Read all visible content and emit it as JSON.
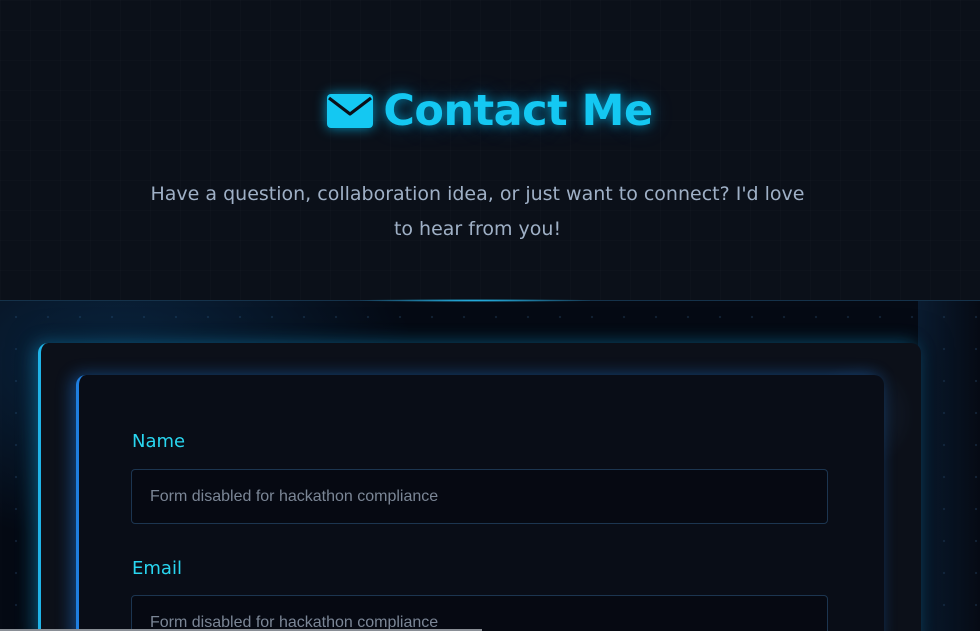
{
  "header": {
    "title": "Contact Me",
    "icon": "envelope-icon",
    "subtitle": "Have a question, collaboration idea, or just want to connect? I'd love to hear from you!"
  },
  "form": {
    "name_label": "Name",
    "name_placeholder": "Form disabled for hackathon compliance",
    "email_label": "Email",
    "email_placeholder": "Form disabled for hackathon compliance"
  },
  "colors": {
    "accent": "#14c8f2",
    "label": "#29d6f0",
    "background": "#0b1019"
  }
}
